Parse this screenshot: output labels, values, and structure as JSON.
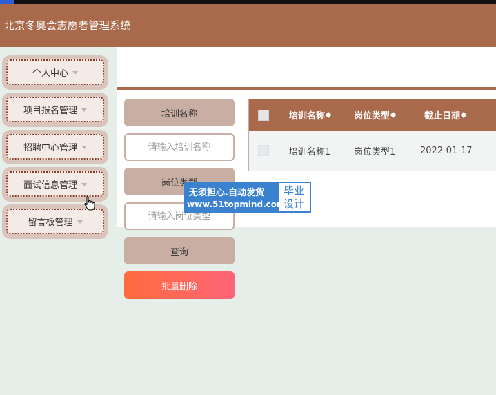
{
  "app": {
    "title": "北京冬奥会志愿者管理系统"
  },
  "sidebar": {
    "items": [
      {
        "label": "个人中心"
      },
      {
        "label": "项目报名管理"
      },
      {
        "label": "招聘中心管理"
      },
      {
        "label": "面试信息管理"
      },
      {
        "label": "留言板管理"
      }
    ]
  },
  "search": {
    "name_label": "培训名称",
    "name_placeholder": "请输入培训名称",
    "type_label": "岗位类型",
    "type_placeholder": "请输入岗位类型",
    "query_button": "查询",
    "batch_delete_button": "批量删除"
  },
  "table": {
    "headers": [
      "培训名称",
      "岗位类型",
      "截止日期"
    ],
    "rows": [
      {
        "name": "培训名称1",
        "type": "岗位类型1",
        "deadline": "2022-01-17"
      }
    ]
  },
  "watermark": {
    "line1": "无须担心.自动发货",
    "line2": "www.51topmind.com",
    "badge_line1": "毕业",
    "badge_line2": "设计"
  },
  "colors": {
    "header": "#a96a4b",
    "accent_label": "#c8aea3",
    "delete_gradient_start": "#ff6b3d",
    "delete_gradient_end": "#ff6478",
    "watermark": "#3a82d0"
  }
}
